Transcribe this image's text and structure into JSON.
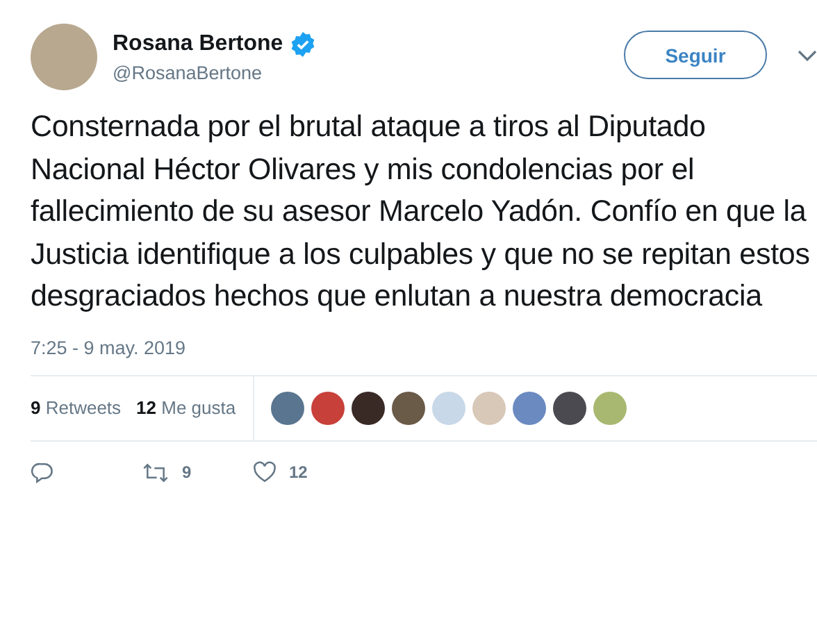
{
  "author": {
    "name": "Rosana Bertone",
    "verified": true,
    "handle": "@RosanaBertone"
  },
  "follow_button": "Seguir",
  "text": "Consternada por el brutal ataque a tiros al Diputado Nacional Héctor Olivares y mis condolencias por el fallecimiento de su asesor Marcelo Yadón. Confío en que la Justicia identifique a los culpables y que no se repitan estos desgraciados hechos que enlutan a nuestra democracia",
  "timestamp": "7:25 - 9 may. 2019",
  "stats": [
    {
      "count": "9",
      "label": "Retweets"
    },
    {
      "count": "12",
      "label": "Me gusta"
    }
  ],
  "likers": [
    {
      "color": "#5a7590"
    },
    {
      "color": "#c8403a"
    },
    {
      "color": "#3a2a26"
    },
    {
      "color": "#6a5a48"
    },
    {
      "color": "#c8d8e8"
    },
    {
      "color": "#d8c8b8"
    },
    {
      "color": "#6a8ac0"
    },
    {
      "color": "#4a4a50"
    },
    {
      "color": "#a8b870"
    }
  ],
  "actions": [
    {
      "kind": "reply"
    },
    {
      "kind": "retweet",
      "count": "9"
    },
    {
      "kind": "like",
      "count": "12"
    }
  ]
}
